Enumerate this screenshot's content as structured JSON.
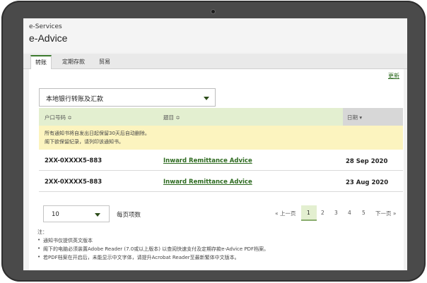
{
  "app": {
    "subtitle": "e-Services",
    "title": "e-Advice"
  },
  "tabs": [
    {
      "label": "转账",
      "active": true
    },
    {
      "label": "定期存款",
      "active": false
    },
    {
      "label": "贸易",
      "active": false
    }
  ],
  "toolbar": {
    "refresh_label": "更新"
  },
  "filter": {
    "selected": "本地银行转账及汇款"
  },
  "table": {
    "columns": [
      {
        "label": "户口号码 ≎"
      },
      {
        "label": "题目 ≎"
      },
      {
        "label": "日期 ▾"
      }
    ],
    "notice": [
      "所有通知书将自发出日起保留30天后自动删除。",
      "阁下欲保留纪录，请列印该通知书。"
    ],
    "rows": [
      {
        "account": "2XX-0XXXX5-883",
        "subject": "Inward Remittance Advice",
        "date": "28 Sep 2020"
      },
      {
        "account": "2XX-0XXXX5-883",
        "subject": "Inward Remittance Advice",
        "date": "23 Aug 2020"
      }
    ]
  },
  "pagination": {
    "per_page": "10",
    "per_page_label": "每页项数",
    "prev": "« 上一页",
    "pages": [
      "1",
      "2",
      "3",
      "4",
      "5"
    ],
    "current_page": "1",
    "next": "下一页 »"
  },
  "notes": {
    "heading": "注：",
    "items": [
      "通知书仅提供英文版本",
      "阁下的电脑必须装置Adobe Reader (7.0或以上版本) 以查阅快速支付及定期存款e-Advice PDF档案。",
      "若PDF档案在开启后，未能显示中文字体，请提升Acrobat Reader至最新繁体中文版本。"
    ]
  },
  "colors": {
    "accent_green": "#2d6a1f",
    "header_green": "#e3efd0",
    "notice_yellow": "#fcf4bf",
    "frame": "#4a4a4a"
  }
}
